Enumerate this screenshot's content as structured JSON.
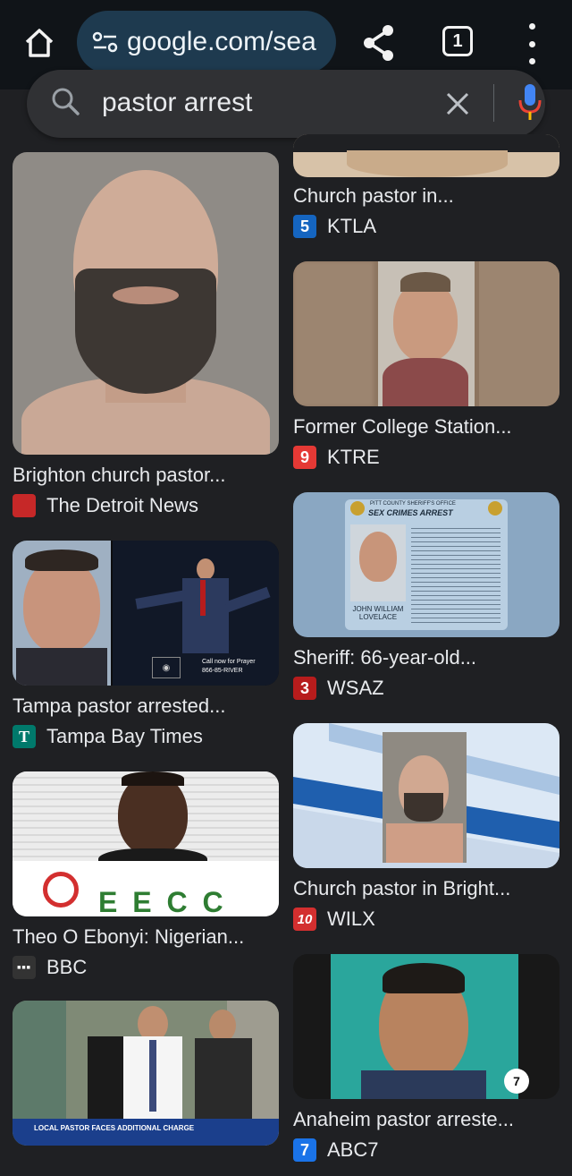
{
  "browser": {
    "url": "google.com/sea",
    "tab_count": "1"
  },
  "search": {
    "query": "pastor arrest"
  },
  "results": [
    {
      "caption": "Church pastor in...",
      "source": "KTLA",
      "favicon_text": "5",
      "favicon_color": "#1565c0"
    },
    {
      "caption": "Brighton church pastor...",
      "source": "The Detroit News",
      "favicon_text": "",
      "favicon_color": "#c62828"
    },
    {
      "caption": "Former College Station...",
      "source": "KTRE",
      "favicon_text": "9",
      "favicon_color": "#e53935"
    },
    {
      "caption": "Tampa pastor arrested...",
      "source": "Tampa Bay Times",
      "favicon_text": "T",
      "favicon_color": "#00796b"
    },
    {
      "caption": "Sheriff: 66-year-old...",
      "source": "WSAZ",
      "favicon_text": "3",
      "favicon_color": "#b71c1c"
    },
    {
      "caption": "Theo O Ebonyi: Nigerian...",
      "source": "BBC",
      "favicon_text": "■■■",
      "favicon_color": "#333333"
    },
    {
      "caption": "Church pastor in Bright...",
      "source": "WILX",
      "favicon_text": "10",
      "favicon_color": "#d32f2f"
    },
    {
      "caption": "Anaheim pastor arreste...",
      "source": "ABC7",
      "favicon_text": "7",
      "favicon_color": "#1a73e8"
    }
  ],
  "image_texts": {
    "sheriff_header": "PITT COUNTY SHERIFF'S OFFICE",
    "sheriff_title": "SEX CRIMES ARREST",
    "sheriff_name": "JOHN WILLIAM LOVELACE",
    "tampa_prayer_line1": "Call now for Prayer",
    "tampa_prayer_line2": "866-85-RIVER",
    "eecc": "E E C C",
    "news_banner": "LOCAL PASTOR FACES ADDITIONAL CHARGE"
  },
  "colors": {
    "background": "#1f2023",
    "topbar": "#101418",
    "url_pill": "#1e3a4f",
    "searchbar": "#303134"
  }
}
